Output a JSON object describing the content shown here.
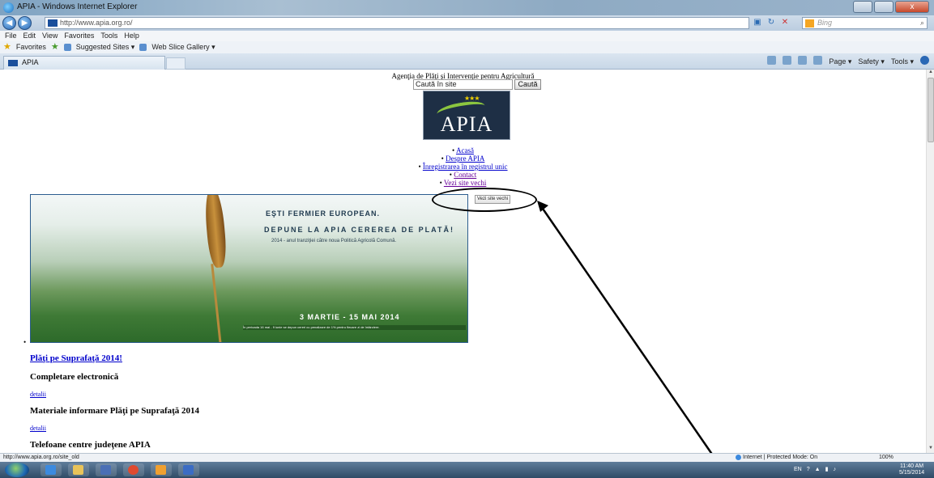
{
  "window": {
    "title": "APIA - Windows Internet Explorer",
    "close_label": "x"
  },
  "address": {
    "url": "http://www.apia.org.ro/",
    "search_placeholder": "Bing"
  },
  "menu": [
    "File",
    "Edit",
    "View",
    "Favorites",
    "Tools",
    "Help"
  ],
  "favorites": {
    "label": "Favorites",
    "items": [
      "Suggested Sites ▾",
      "Web Slice Gallery ▾"
    ]
  },
  "tab": {
    "title": "APIA"
  },
  "command_bar": [
    "Page ▾",
    "Safety ▾",
    "Tools ▾"
  ],
  "page": {
    "site_title": "Agenţia de Plăţi şi Intervenţie pentru Agricultură",
    "search_value": "Caută în site",
    "search_button": "Caută",
    "logo_text": "APIA",
    "nav": [
      "Acasă",
      "Despre APIA",
      "Înregistrarea în registrul unic",
      "Contact",
      "Vezi site vechi"
    ],
    "old_site_button": "Vezi site vechi",
    "banner": {
      "line1": "EŞTI FERMIER EUROPEAN.",
      "line2": "DEPUNE LA APIA CEREREA DE PLATĂ!",
      "line3": "2014 - anul tranziţiei către noua Politică Agricolă Comună.",
      "dates": "3 MARTIE - 15 MAI 2014",
      "footnote": "În perioada 16 mai - 9 iunie se depun cereri cu penalizare de 1% pentru fiecare zi de întârziere."
    },
    "bullet": "•",
    "headline_link": "Plăţi pe Suprafaţă 2014!",
    "section1": "Completare electronică",
    "details1": "detalii",
    "section2": "Materiale informare Plăţi pe Suprafaţă 2014",
    "details2": "detalii",
    "section3": "Telefoane centre judeţene APIA"
  },
  "status": {
    "url": "http://www.apia.org.ro/site_old",
    "zone": "Internet | Protected Mode: On",
    "zoom": "100%"
  },
  "taskbar": {
    "lang": "EN",
    "time": "11:40 AM",
    "date": "5/15/2014"
  },
  "colors": {
    "link": "#0000cc",
    "visited": "#660099",
    "annotation": "#000000"
  }
}
